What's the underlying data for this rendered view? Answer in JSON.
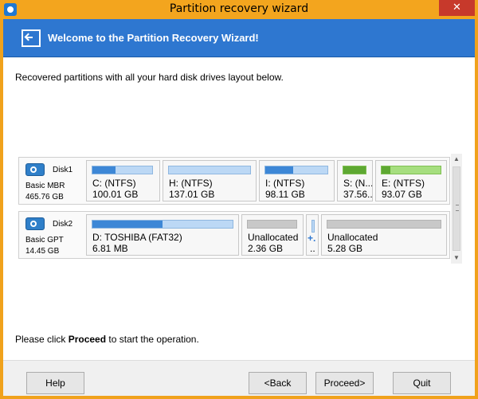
{
  "window": {
    "title": "Partition recovery wizard",
    "close_label": "✕"
  },
  "header": {
    "title": "Welcome to the Partition Recovery Wizard!"
  },
  "content": {
    "intro": "Recovered partitions with all your hard disk drives layout below.",
    "footer_prefix": "Please click ",
    "footer_bold": "Proceed",
    "footer_suffix": " to start the operation."
  },
  "disks": [
    {
      "name": "Disk1",
      "type": "Basic MBR",
      "size": "465.76 GB",
      "partitions": [
        {
          "label": "C: (NTFS)",
          "size": "100.01 GB",
          "bar": "blue",
          "used_fraction": 0.38
        },
        {
          "label": "H: (NTFS)",
          "size": "137.01 GB",
          "bar": "blue",
          "used_fraction": 0.0
        },
        {
          "label": "I: (NTFS)",
          "size": "98.11 GB",
          "bar": "blue",
          "used_fraction": 0.45
        },
        {
          "label": "S: (N...",
          "size": "37.56...",
          "bar": "green",
          "used_fraction": 1.0
        },
        {
          "label": "E: (NTFS)",
          "size": "93.07 GB",
          "bar": "green",
          "used_fraction": 0.15
        }
      ]
    },
    {
      "name": "Disk2",
      "type": "Basic GPT",
      "size": "14.45 GB",
      "partitions": [
        {
          "label": "D: TOSHIBA (FAT32)",
          "size": "6.81 MB",
          "bar": "blue",
          "used_fraction": 0.5
        },
        {
          "label": "Unallocated",
          "size": "2.36 GB",
          "bar": "gray",
          "used_fraction": 0.0
        },
        {
          "label": "+.",
          "size": "..",
          "bar": "blue",
          "used_fraction": 0.0
        },
        {
          "label": "Unallocated",
          "size": "5.28 GB",
          "bar": "gray",
          "used_fraction": 0.0
        }
      ]
    }
  ],
  "buttons": {
    "help": "Help",
    "back": "<Back",
    "proceed": "Proceed>",
    "quit": "Quit"
  },
  "colors": {
    "title_bar": "#f3a51e",
    "header_band": "#2e77d0",
    "partition_blue": "#3d87d6",
    "partition_green": "#5ea832",
    "close_red": "#c7392b"
  }
}
